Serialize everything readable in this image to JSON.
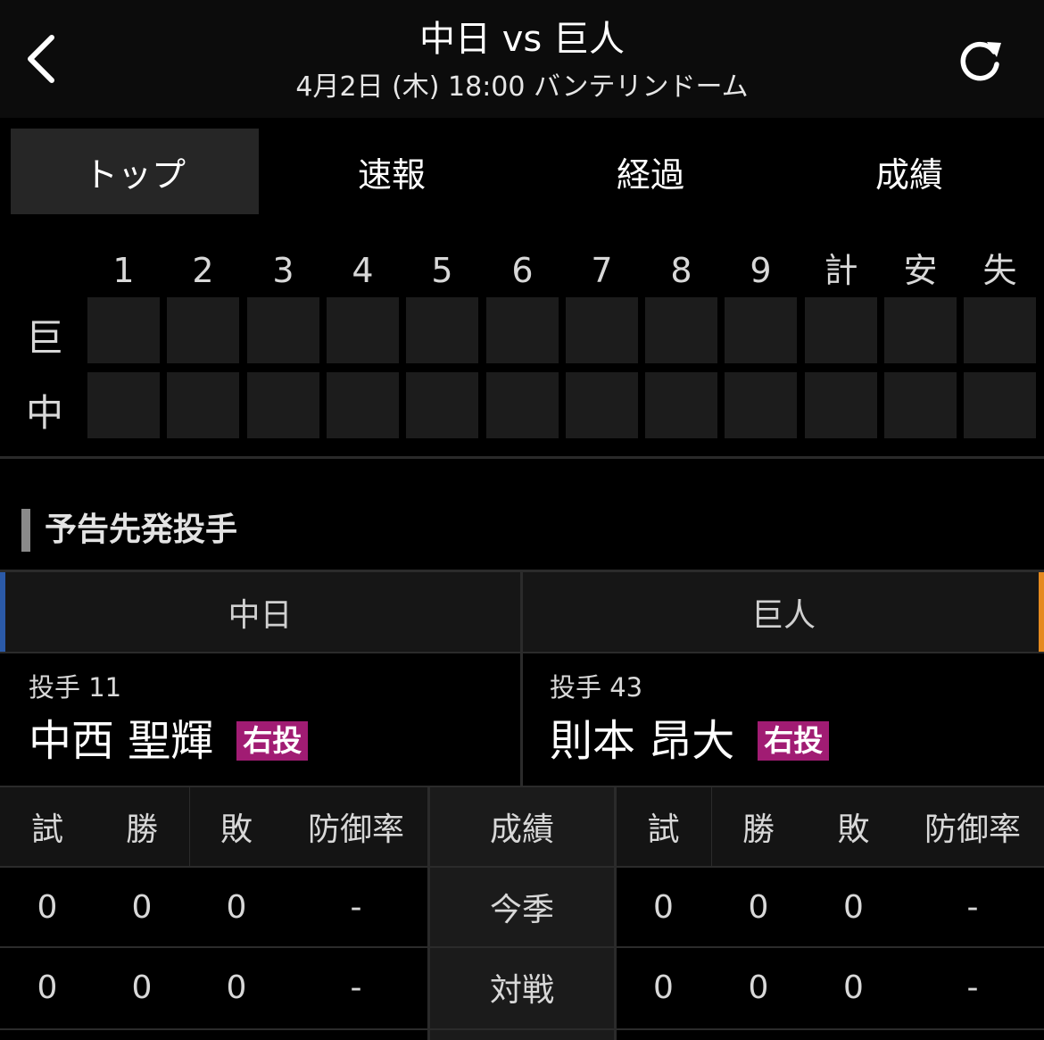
{
  "header": {
    "title": "中日 vs 巨人",
    "subtitle": "4月2日 (木) 18:00 バンテリンドーム",
    "back_icon": "chevron-left-icon",
    "refresh_icon": "refresh-icon"
  },
  "tabs": [
    {
      "label": "トップ",
      "active": true
    },
    {
      "label": "速報",
      "active": false
    },
    {
      "label": "経過",
      "active": false
    },
    {
      "label": "成績",
      "active": false
    }
  ],
  "scoreboard": {
    "columns": [
      "1",
      "2",
      "3",
      "4",
      "5",
      "6",
      "7",
      "8",
      "9",
      "計",
      "安",
      "失"
    ],
    "teams": [
      {
        "label": "巨",
        "scores": [
          "",
          "",
          "",
          "",
          "",
          "",
          "",
          "",
          "",
          "",
          "",
          ""
        ]
      },
      {
        "label": "中",
        "scores": [
          "",
          "",
          "",
          "",
          "",
          "",
          "",
          "",
          "",
          "",
          "",
          ""
        ]
      }
    ]
  },
  "section": {
    "title": "予告先発投手"
  },
  "pitchers": {
    "home": {
      "team": "中日",
      "accent": "#2b5aa8",
      "number_label": "投手 11",
      "name": "中西 聖輝",
      "hand": "右投"
    },
    "away": {
      "team": "巨人",
      "accent": "#e58a1f",
      "number_label": "投手 43",
      "name": "則本 昂大",
      "hand": "右投"
    }
  },
  "stats": {
    "headers": [
      "試",
      "勝",
      "敗",
      "防御率"
    ],
    "middle_header": "成績",
    "rows": [
      {
        "label": "今季",
        "home": [
          "0",
          "0",
          "0",
          "-"
        ],
        "away": [
          "0",
          "0",
          "0",
          "-"
        ]
      },
      {
        "label": "対戦",
        "home": [
          "0",
          "0",
          "0",
          "-"
        ],
        "away": [
          "0",
          "0",
          "0",
          "-"
        ]
      }
    ]
  }
}
